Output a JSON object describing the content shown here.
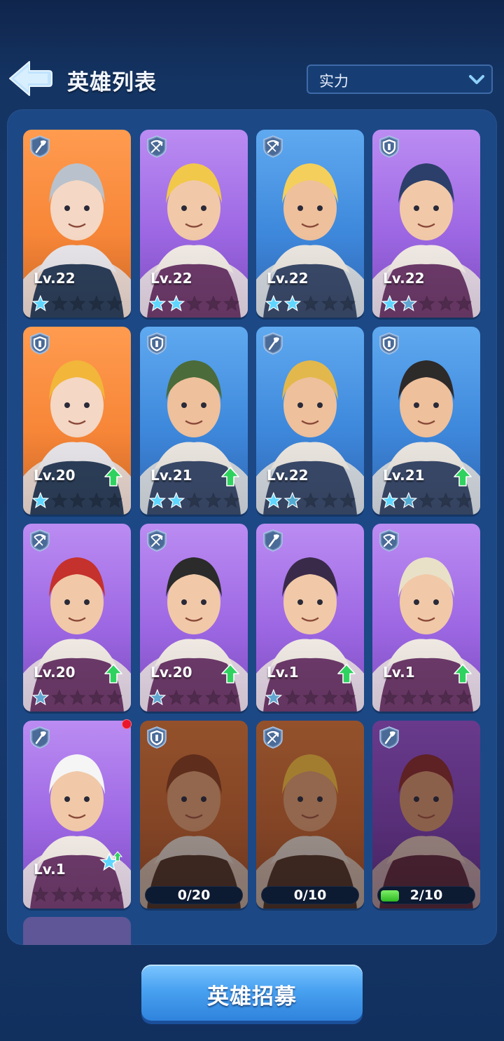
{
  "header": {
    "title": "英雄列表",
    "back_icon": "back-arrow-icon",
    "sort": {
      "selected": "实力",
      "icon": "chevron-down-icon"
    }
  },
  "heroes": [
    {
      "card_color": "orange",
      "class_icon": "shovel-icon",
      "level": "Lv.22",
      "stars": [
        2,
        0,
        0,
        0,
        0
      ],
      "upgrade": false
    },
    {
      "card_color": "purple",
      "class_icon": "crossbow-icon",
      "level": "Lv.22",
      "stars": [
        2,
        2,
        0,
        0,
        0
      ],
      "upgrade": false
    },
    {
      "card_color": "blue",
      "class_icon": "crossbow-icon",
      "level": "Lv.22",
      "stars": [
        2,
        2,
        0,
        0,
        0
      ],
      "upgrade": false
    },
    {
      "card_color": "purple",
      "class_icon": "shield-icon",
      "level": "Lv.22",
      "stars": [
        2,
        1,
        0,
        0,
        0
      ],
      "upgrade": false
    },
    {
      "card_color": "orange",
      "class_icon": "shield-icon",
      "level": "Lv.20",
      "stars": [
        2,
        0,
        0,
        0,
        0
      ],
      "upgrade": true
    },
    {
      "card_color": "blue",
      "class_icon": "shield-icon",
      "level": "Lv.21",
      "stars": [
        2,
        2,
        0,
        0,
        0
      ],
      "upgrade": true
    },
    {
      "card_color": "blue",
      "class_icon": "shovel-icon",
      "level": "Lv.22",
      "stars": [
        2,
        1,
        0,
        0,
        0
      ],
      "upgrade": false
    },
    {
      "card_color": "blue",
      "class_icon": "shield-icon",
      "level": "Lv.21",
      "stars": [
        2,
        1,
        0,
        0,
        0
      ],
      "upgrade": true
    },
    {
      "card_color": "purple",
      "class_icon": "crossbow-icon",
      "level": "Lv.20",
      "stars": [
        1,
        0,
        0,
        0,
        0
      ],
      "upgrade": true
    },
    {
      "card_color": "purple",
      "class_icon": "crossbow-icon",
      "level": "Lv.20",
      "stars": [
        1,
        0,
        0,
        0,
        0
      ],
      "upgrade": true
    },
    {
      "card_color": "purple",
      "class_icon": "shovel-icon",
      "level": "Lv.1",
      "stars": [
        1,
        0,
        0,
        0,
        0
      ],
      "upgrade": true
    },
    {
      "card_color": "purple",
      "class_icon": "crossbow-icon",
      "level": "Lv.1",
      "stars": [
        0,
        0,
        0,
        0,
        0
      ],
      "upgrade": true
    },
    {
      "card_color": "purple",
      "class_icon": "shovel-icon",
      "level": "Lv.1",
      "stars": [
        0,
        0,
        0,
        0,
        0
      ],
      "upgrade": true,
      "star_upgrade": true,
      "new_badge": true
    },
    {
      "card_color": "locked-brown",
      "class_icon": "shield-icon",
      "shards": "0/20",
      "shard_progress": 0
    },
    {
      "card_color": "locked-brown",
      "class_icon": "crossbow-icon",
      "shards": "0/10",
      "shard_progress": 0
    },
    {
      "card_color": "locked-purple",
      "class_icon": "shovel-icon",
      "shards": "2/10",
      "shard_progress": 0.2
    }
  ],
  "colors": {
    "star_filled": "#5fd6ff",
    "star_empty": "rgba(0,0,0,0.22)",
    "upgrade_arrow": "#2fd25f",
    "shard_fill": "#3fcb2c"
  },
  "footer": {
    "recruit_label": "英雄招募"
  }
}
